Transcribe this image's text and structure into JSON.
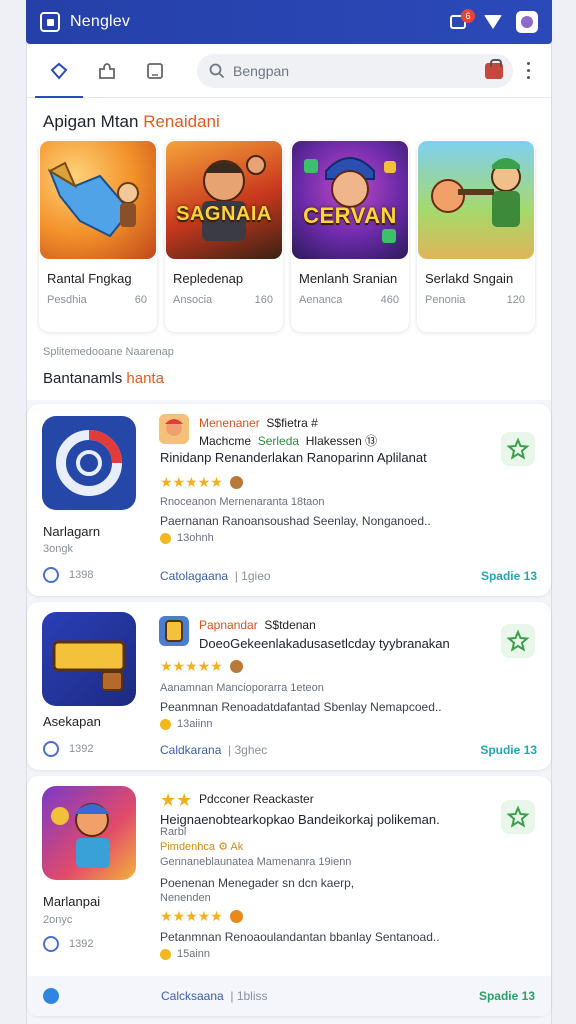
{
  "status_bar": {
    "title": "Nenglev",
    "badge_count": "6"
  },
  "search": {
    "placeholder": "Bengpan"
  },
  "featured": {
    "title_main": "Apigan Mtan",
    "title_accent": "Renaidani",
    "cards": [
      {
        "title": "Rantal Fngkag",
        "meta_left": "Pesdhia",
        "meta_right": "60",
        "word": ""
      },
      {
        "title": "Repledenap",
        "meta_left": "Ansocia",
        "meta_right": "160",
        "word": "SAGNAIA"
      },
      {
        "title": "Menlanh Sranian",
        "meta_left": "Aenanca",
        "meta_right": "460",
        "word": "CERVAN"
      },
      {
        "title": "Serlakd Sngain",
        "meta_left": "Penonia",
        "meta_right": "120",
        "word": ""
      }
    ],
    "subtitle": "Splitemedooane Naarenap",
    "section2_main": "Bantanamls",
    "section2_accent": "hanta"
  },
  "list": [
    {
      "name": "Narlagarn",
      "sub": "3ongk",
      "count": "1398",
      "dev_orange": "Menenaner",
      "dev_rest": "S$fietra #",
      "dev2_dark": "Machcme",
      "dev2_green": "Serleda",
      "dev2_rest": "Hlakessen ⑬",
      "tagline": "Rinidanp Renanderlakan Ranoparinn   Aplilanat",
      "desc": "Rnoceanon Mernenaranta 18taon",
      "desc2": "Paernanan Ranoansoushad Seenlay,  Nonganoed..",
      "time": "13ohnh",
      "category": "Catolagaana",
      "category_muted": "| 1gieo",
      "open": "Spadie 13"
    },
    {
      "name": "Asekapan",
      "sub": "",
      "count": "1392",
      "dev_orange": "Papnandar",
      "dev_rest": "S$tdenan",
      "tagline": "DoeoGekeenlakadusasetlcday tyybranakan",
      "desc": "Aanamnan Mancioporarra 1eteon",
      "desc2": "Peanmnan Renoadatdafantad Sbenlay  Nemapcoed..",
      "time": "13aiinn",
      "category": "Caldkarana",
      "category_muted": "| 3ghec",
      "open": "Spudie 13"
    },
    {
      "name": "Marlanpai",
      "sub": "2onyc",
      "count": "1392",
      "dev_rest": "Pdcconer  Reackaster",
      "tagline": "Heignaenobtearkopkao Bandeikorkaj polikeman.",
      "tagline2": "Rarbl",
      "mini_meta": "Pimdenhca  ⚙ Ak",
      "desc": "Gennaneblaunatea Mamenanra 19ienn",
      "desc2": "Poenenan Menegader sn dcn kaerp,",
      "desc3": "Nenenden",
      "desc4": "Petanmnan Renoaoulandantan bbanlay  Sentanoad..",
      "time": "15ainn",
      "footer_category": "Calcksaana",
      "footer_category_muted": "| 1bliss",
      "footer_open": "Spadie 13"
    }
  ]
}
